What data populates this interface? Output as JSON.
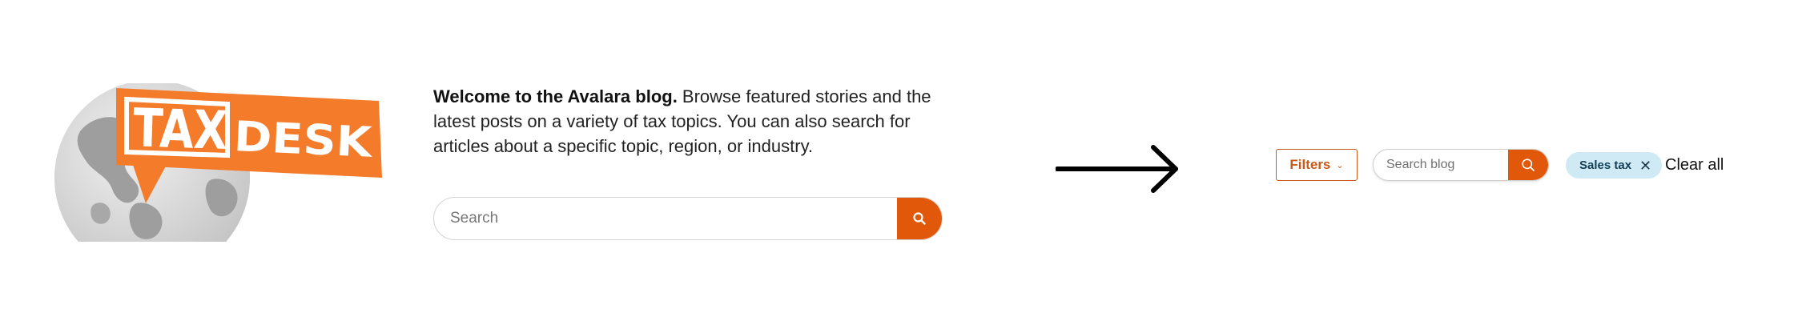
{
  "logo": {
    "word_left": "TAX",
    "word_right": "DESK",
    "colors": {
      "orange": "#f47b2a",
      "globe": "#bdbdbd",
      "land": "#9e9e9e"
    }
  },
  "intro": {
    "bold_text": "Welcome to the Avalara blog.",
    "body_text": " Browse featured stories and the latest posts on a variety of tax topics. You can also search for articles about a specific topic, region, or industry."
  },
  "main_search": {
    "placeholder": "Search",
    "button_icon": "search-icon"
  },
  "filter_bar": {
    "filters_label": "Filters",
    "filters_icon": "chevron-down-icon",
    "search_placeholder": "Search blog",
    "search_icon": "search-icon",
    "active_tags": [
      {
        "label": "Sales tax",
        "remove_icon": "close-icon"
      }
    ],
    "clear_all_label": "Clear all"
  },
  "colors": {
    "accent": "#e2580a",
    "filters_border": "#c95a1a",
    "tag_bg": "#cfeaf5",
    "tag_text": "#123f55"
  }
}
